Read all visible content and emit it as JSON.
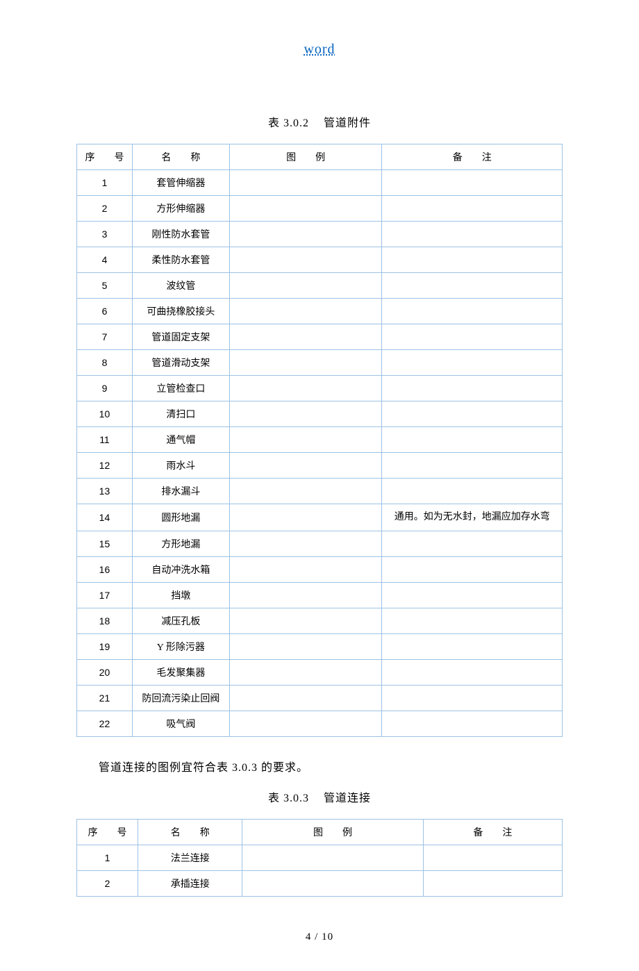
{
  "header_link": "word",
  "table1_title_num": "表 3.0.2",
  "table1_title_text": "管道附件",
  "headers": {
    "num": "序　　号",
    "name": "名　　称",
    "fig": "图　　例",
    "note": "备　　注"
  },
  "table1": [
    {
      "n": "1",
      "name": "套管伸缩器",
      "note": ""
    },
    {
      "n": "2",
      "name": "方形伸缩器",
      "note": ""
    },
    {
      "n": "3",
      "name": "刚性防水套管",
      "note": ""
    },
    {
      "n": "4",
      "name": "柔性防水套管",
      "note": ""
    },
    {
      "n": "5",
      "name": "波纹管",
      "note": ""
    },
    {
      "n": "6",
      "name": "可曲挠橡胶接头",
      "note": ""
    },
    {
      "n": "7",
      "name": "管道固定支架",
      "note": ""
    },
    {
      "n": "8",
      "name": "管道滑动支架",
      "note": ""
    },
    {
      "n": "9",
      "name": "立管检查口",
      "note": ""
    },
    {
      "n": "10",
      "name": "清扫口",
      "note": ""
    },
    {
      "n": "11",
      "name": "通气帽",
      "note": ""
    },
    {
      "n": "12",
      "name": "雨水斗",
      "note": ""
    },
    {
      "n": "13",
      "name": "排水漏斗",
      "note": ""
    },
    {
      "n": "14",
      "name": "圆形地漏",
      "note": "通用。如为无水封，地漏应加存水弯"
    },
    {
      "n": "15",
      "name": "方形地漏",
      "note": ""
    },
    {
      "n": "16",
      "name": "自动冲洗水箱",
      "note": ""
    },
    {
      "n": "17",
      "name": "挡墩",
      "note": ""
    },
    {
      "n": "18",
      "name": "减压孔板",
      "note": ""
    },
    {
      "n": "19",
      "name": "Y 形除污器",
      "note": ""
    },
    {
      "n": "20",
      "name": "毛发聚集器",
      "note": ""
    },
    {
      "n": "21",
      "name": "防回流污染止回阀",
      "note": ""
    },
    {
      "n": "22",
      "name": "吸气阀",
      "note": ""
    }
  ],
  "mid_para": "管道连接的图例宜符合表 3.0.3 的要求。",
  "table2_title_num": "表 3.0.3",
  "table2_title_text": "管道连接",
  "table2": [
    {
      "n": "1",
      "name": "法兰连接",
      "note": ""
    },
    {
      "n": "2",
      "name": "承插连接",
      "note": ""
    }
  ],
  "footer": "4 / 10"
}
